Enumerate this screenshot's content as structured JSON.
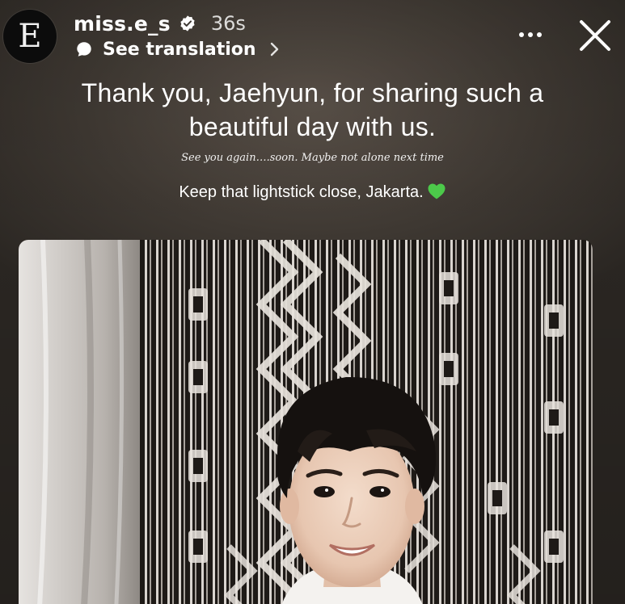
{
  "header": {
    "avatar_letter": "E",
    "username": "miss.e_s",
    "timestamp": "36s",
    "see_translation": "See translation"
  },
  "caption": {
    "line_main": "Thank you, Jaehyun, for sharing such a beautiful day with us.",
    "line_sub": "See you again….soon. Maybe not alone next time",
    "line_third": "Keep that lightstick close, Jakarta."
  },
  "colors": {
    "heart": "#4cc94a",
    "text": "#ffffff"
  },
  "icons": {
    "verified": "verified-badge-icon",
    "translation": "speech-bubble-icon",
    "chevron": "chevron-right-icon",
    "more": "more-options-icon",
    "close": "close-icon",
    "heart": "green-heart-icon"
  }
}
